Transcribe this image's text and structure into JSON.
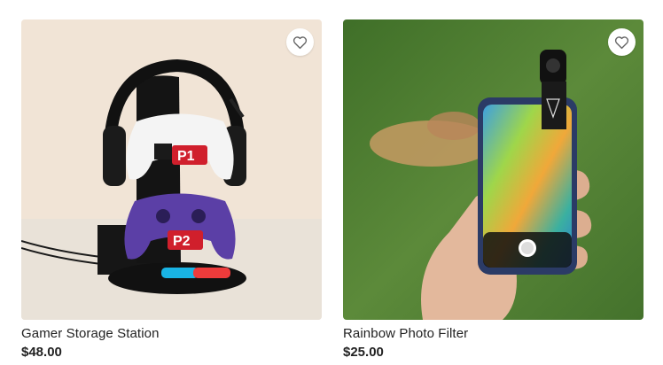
{
  "products": [
    {
      "title": "Gamer Storage Station",
      "price": "$48.00",
      "badges": [
        "P1",
        "P2"
      ],
      "favorite_icon": "heart-outline-icon",
      "colors": {
        "bg": "#f1e4d6",
        "floor": "#e8e2d9",
        "controller_top": "#f4f4f4",
        "controller_bottom": "#5b3fa6",
        "joycon_left": "#19b4e5",
        "joycon_right": "#ee3b3b"
      }
    },
    {
      "title": "Rainbow Photo Filter",
      "price": "$25.00",
      "favorite_icon": "heart-outline-icon",
      "colors": {
        "grass": "#4f7f32",
        "phone": "#2b3b66",
        "skin": "#e3b89c"
      }
    }
  ]
}
